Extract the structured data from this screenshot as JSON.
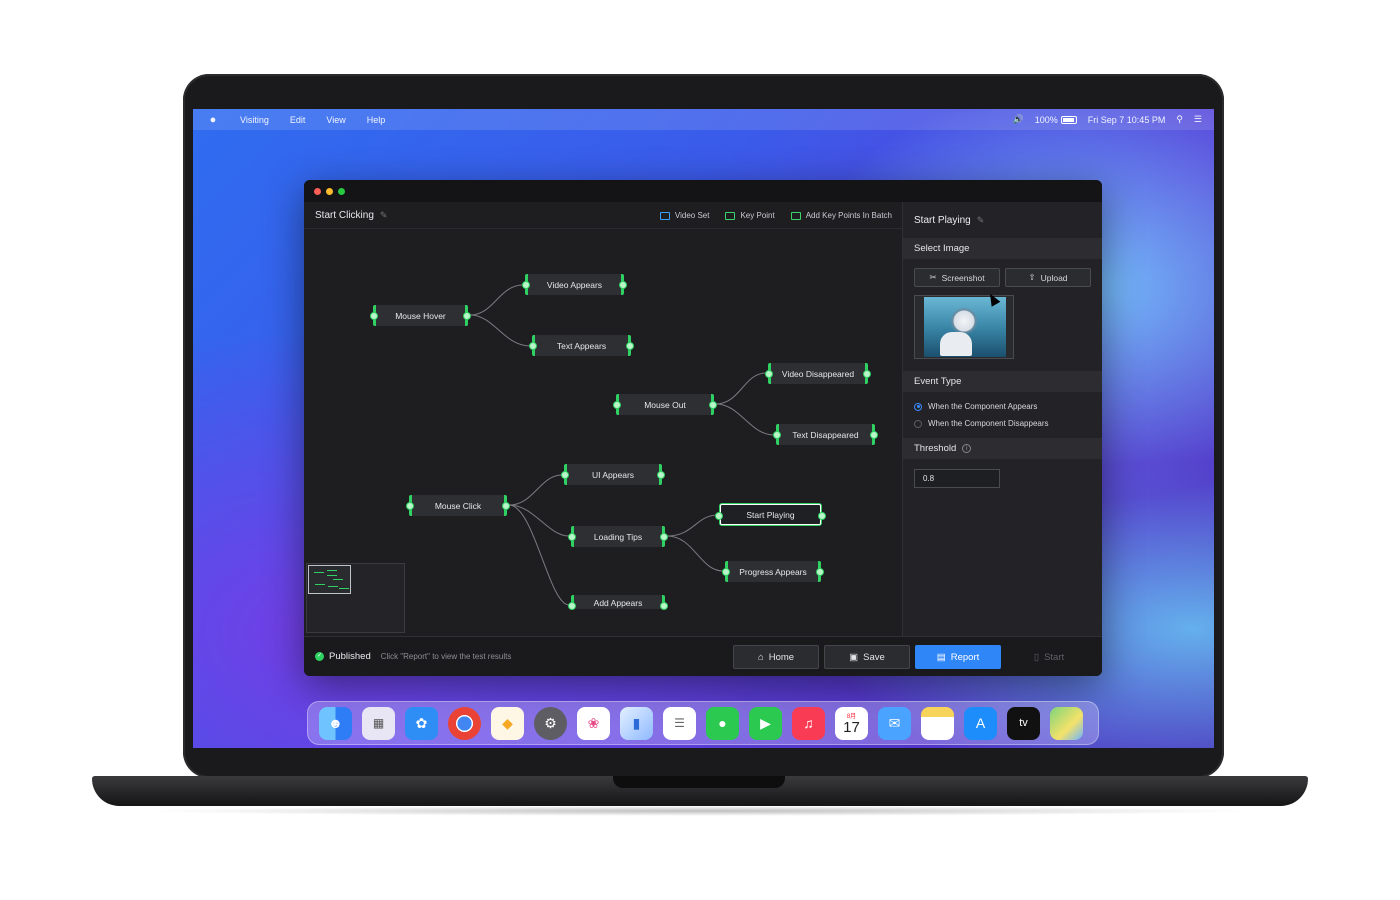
{
  "menubar": {
    "items": [
      "Visiting",
      "Edit",
      "View",
      "Help"
    ],
    "battery": "100%",
    "datetime": "Fri Sep 7 10:45 PM"
  },
  "canvas": {
    "title": "Start Clicking",
    "toolbar": {
      "video_set": "Video Set",
      "key_point": "Key Point",
      "add_batch": "Add Key Points In Batch"
    },
    "nodes": {
      "mouse_hover": "Mouse Hover",
      "video_appears": "Video Appears",
      "text_appears": "Text Appears",
      "mouse_out": "Mouse Out",
      "video_disappeared": "Video Disappeared",
      "text_disappeared": "Text Disappeared",
      "mouse_click": "Mouse Click",
      "ui_appears": "UI Appears",
      "loading_tips": "Loading Tips",
      "start_playing": "Start Playing",
      "progress_appears": "Progress Appears",
      "add_appears": "Add Appears"
    }
  },
  "panel": {
    "title": "Start Playing",
    "select_image": "Select Image",
    "screenshot": "Screenshot",
    "upload": "Upload",
    "event_type": "Event Type",
    "radio_appears": "When the Component Appears",
    "radio_disappears": "When the Component Disappears",
    "selected_event": "When the Component Appears",
    "threshold": "Threshold",
    "threshold_value": "0.8"
  },
  "footer": {
    "status": "Published",
    "hint": "Click \"Report\" to view the test results",
    "home": "Home",
    "save": "Save",
    "report": "Report",
    "start": "Start"
  },
  "dock": {
    "calendar_month": "8月",
    "calendar_day": "17",
    "tv_label": "tv"
  },
  "colors": {
    "accent_green": "#2ed162",
    "primary_blue": "#2f86f6"
  }
}
